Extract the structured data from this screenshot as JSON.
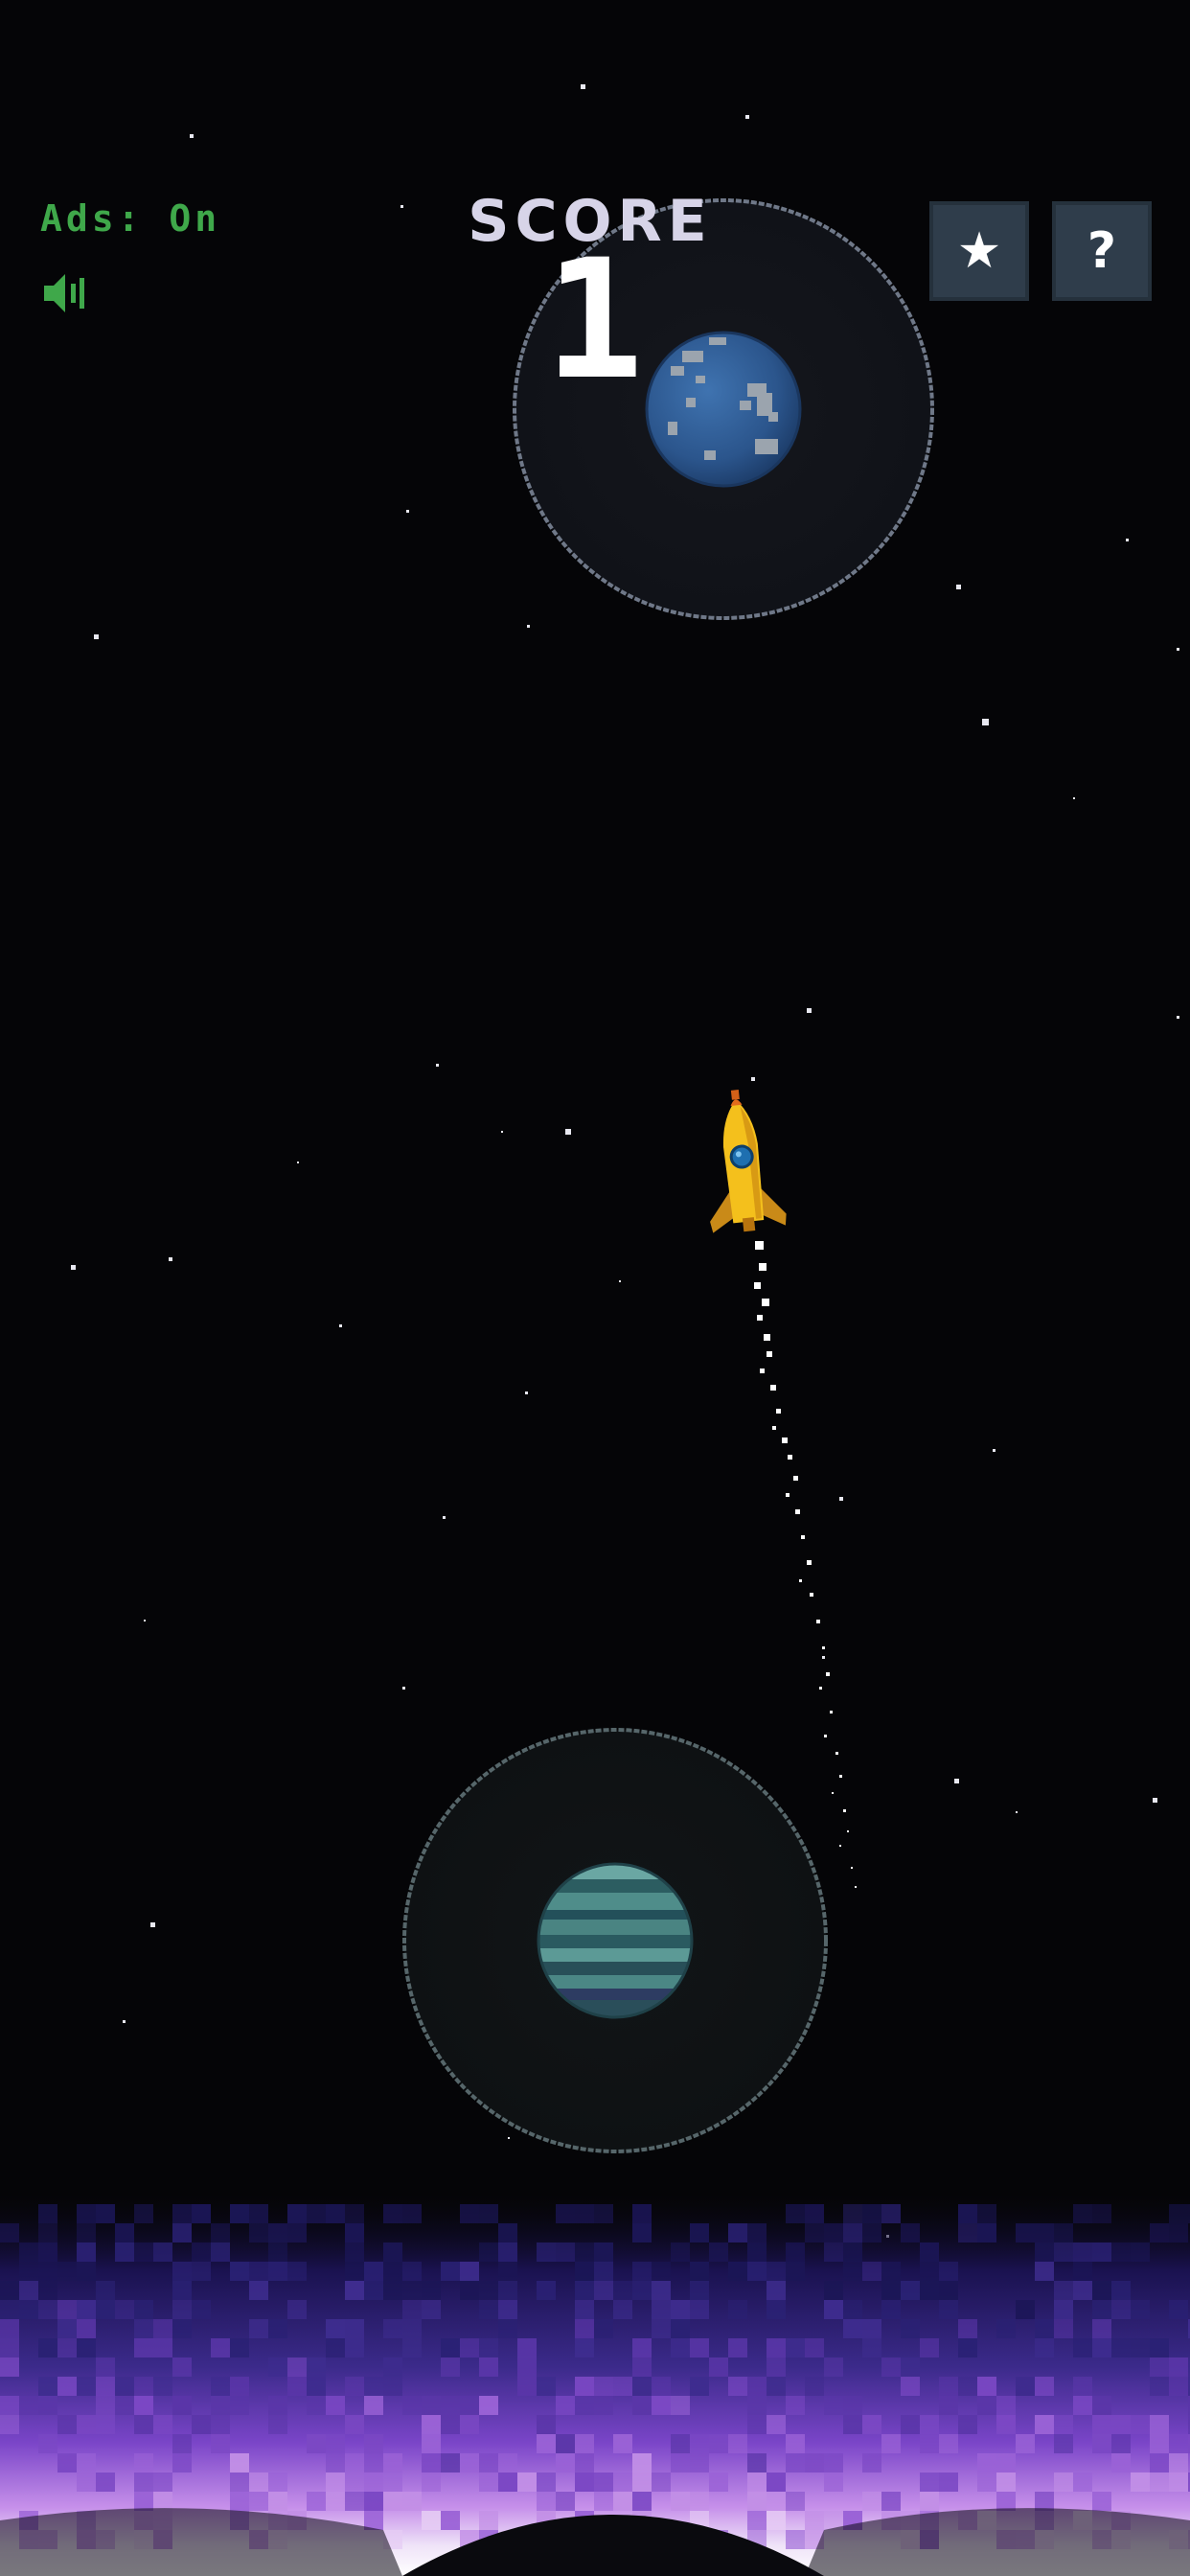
{
  "hud": {
    "ads_label": "Ads: On",
    "sound_icon": "speaker-on-icon",
    "score_label": "SCORE",
    "score_value": "1",
    "star_button_symbol": "★",
    "star_button_icon": "star-icon",
    "help_button_symbol": "?",
    "help_button_icon": "question-mark-icon"
  },
  "scene": {
    "top_planet": {
      "type": "blue-rocky-planet",
      "has_orbit": true
    },
    "bottom_planet": {
      "type": "teal-gas-giant",
      "has_orbit": true
    },
    "rocket": {
      "type": "yellow-rocket",
      "exhaust": "white-particle-trail"
    },
    "background": "starfield",
    "floor": "purple-nebula-glow"
  },
  "colors": {
    "space": "#050507",
    "hud_green": "#3fa84a",
    "score_text": "#ffffff",
    "button_bg": "#2f3d4b",
    "orbit_line": "#7f8a9b",
    "planet_blue": "#2f5a94",
    "planet_teal": "#3f7e7e",
    "rocket_yellow": "#f4c01c",
    "nebula_purple": "#8a4bd0"
  }
}
